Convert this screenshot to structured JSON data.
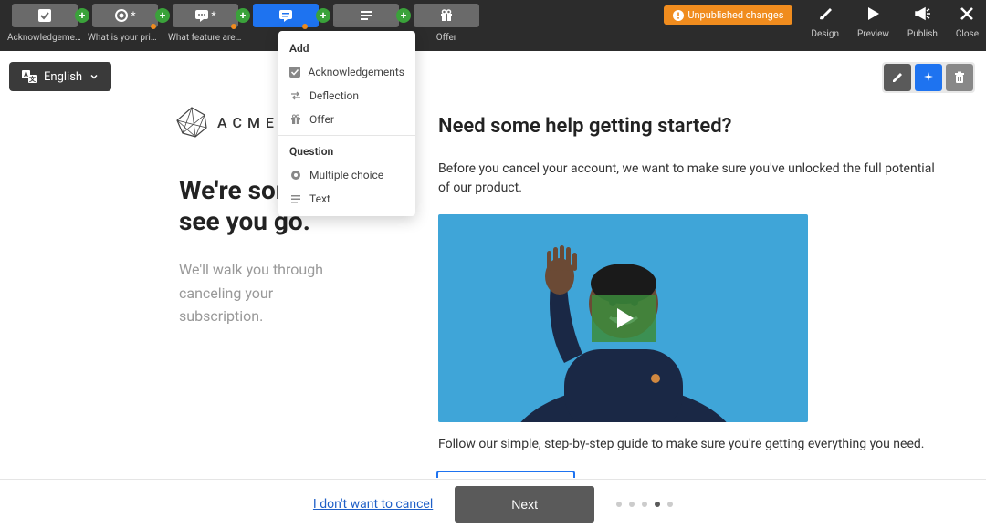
{
  "toolbar": {
    "steps": [
      {
        "label": "Acknowledgements"
      },
      {
        "label": "What is your prim…"
      },
      {
        "label": "What feature are …"
      },
      {
        "label": ""
      },
      {
        "label": "…."
      },
      {
        "label": "Offer"
      }
    ],
    "unpublished": "Unpublished changes",
    "buttons": {
      "design": "Design",
      "preview": "Preview",
      "publish": "Publish",
      "close": "Close"
    }
  },
  "dropdown": {
    "header1": "Add",
    "items1": [
      {
        "label": "Acknowledgements"
      },
      {
        "label": "Deflection"
      },
      {
        "label": "Offer"
      }
    ],
    "header2": "Question",
    "items2": [
      {
        "label": "Multiple choice"
      },
      {
        "label": "Text"
      }
    ]
  },
  "language": {
    "label": "English"
  },
  "page": {
    "logo_text": "ACME",
    "heading": "We're sorry to see you go.",
    "subtext": "We'll walk you through canceling your subscription.",
    "help_heading": "Need some help getting started?",
    "help_p1": "Before you cancel your account, we want to make sure you've unlocked the full potential of our product.",
    "help_p2": "Follow our simple, step-by-step guide to make sure you're getting everything you need."
  },
  "footer": {
    "cancel_link": "I don't want to cancel",
    "next": "Next",
    "dots_total": 5,
    "active_dot": 3
  }
}
